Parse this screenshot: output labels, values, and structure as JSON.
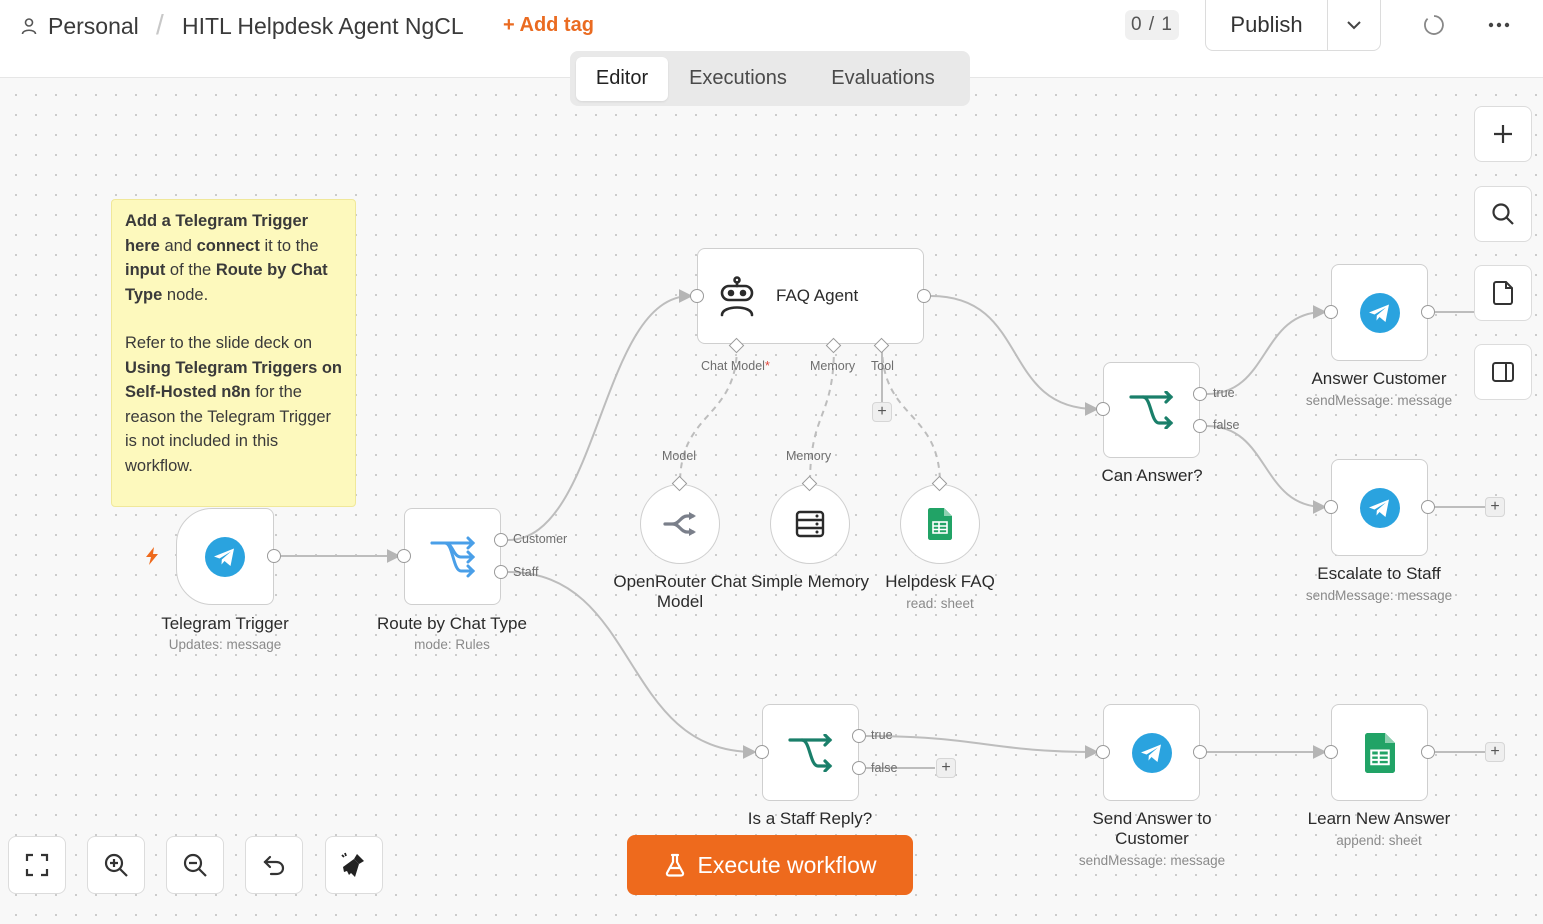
{
  "header": {
    "workspace": "Personal",
    "workflow_title": "HITL Helpdesk Agent NgCL",
    "add_tag": "+ Add tag",
    "counter": "0 / 1",
    "publish": "Publish"
  },
  "tabs": [
    {
      "label": "Editor",
      "active": true
    },
    {
      "label": "Executions",
      "active": false
    },
    {
      "label": "Evaluations",
      "active": false
    }
  ],
  "sticky_note": {
    "para1": [
      {
        "text": "Add a Telegram Trigger",
        "bold": true
      },
      {
        "text": "here",
        "bold": true
      },
      {
        "text": "and",
        "bold": false
      },
      {
        "text": "connect",
        "bold": true
      },
      {
        "text": "it to the",
        "bold": false
      },
      {
        "text": "input",
        "bold": true
      },
      {
        "text": "of the",
        "bold": false
      },
      {
        "text": "Route by Chat Type",
        "bold": true
      },
      {
        "text": "node.",
        "bold": false
      }
    ],
    "para2": [
      {
        "text": "Refer to the slide deck on",
        "bold": false
      },
      {
        "text": "Using Telegram Triggers on Self-Hosted n8n",
        "bold": true
      },
      {
        "text": "for the reason the Telegram Trigger is not included in this workflow.",
        "bold": false
      }
    ]
  },
  "nodes": {
    "telegram_trigger": {
      "label": "Telegram Trigger",
      "sub": "Updates: message"
    },
    "route_by_chat_type": {
      "label": "Route by Chat Type",
      "sub": "mode: Rules",
      "out1": "Customer",
      "out2": "Staff"
    },
    "faq_agent": {
      "label": "FAQ Agent",
      "port_chat_model": "Chat Model",
      "port_chat_model_req": "*",
      "port_memory": "Memory",
      "port_tool": "Tool"
    },
    "openrouter": {
      "label1": "OpenRouter Chat",
      "label2": "Model",
      "port": "Model"
    },
    "simple_memory": {
      "label": "Simple Memory",
      "port": "Memory"
    },
    "helpdesk_faq": {
      "label": "Helpdesk FAQ",
      "sub": "read: sheet"
    },
    "can_answer": {
      "label": "Can Answer?",
      "out_true": "true",
      "out_false": "false"
    },
    "answer_customer": {
      "label": "Answer Customer",
      "sub": "sendMessage: message"
    },
    "escalate_to_staff": {
      "label": "Escalate to Staff",
      "sub": "sendMessage: message"
    },
    "is_staff_reply": {
      "label": "Is a Staff Reply?",
      "out_true": "true",
      "out_false": "false"
    },
    "send_answer": {
      "label1": "Send Answer to",
      "label2": "Customer",
      "sub": "sendMessage: message"
    },
    "learn_new_answer": {
      "label": "Learn New Answer",
      "sub": "append: sheet"
    }
  },
  "toolbar": {
    "execute": "Execute workflow"
  },
  "plus_glyph": "+",
  "colors": {
    "accent": "#ee6a1d",
    "telegram": "#2aa3df",
    "if_node": "#1a7f6a",
    "sheets": "#21a366",
    "router": "#4a9fe8",
    "sticky": "#fdf9bd"
  }
}
